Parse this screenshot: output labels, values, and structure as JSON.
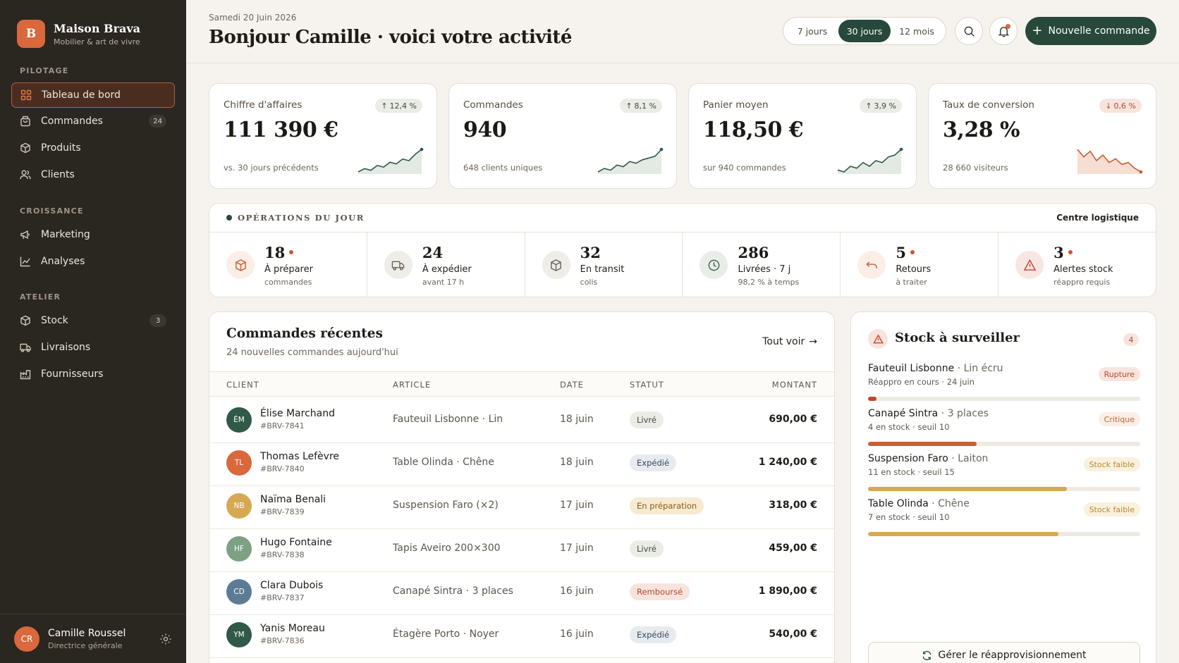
{
  "brand": {
    "initial": "B",
    "name": "Maison Brava",
    "tagline": "Mobilier & art de vivre"
  },
  "sidebar": {
    "sections": [
      {
        "label": "PILOTAGE"
      },
      {
        "label": "CROISSANCE"
      },
      {
        "label": "ATELIER"
      }
    ],
    "items": [
      {
        "label": "Tableau de bord",
        "icon": "grid-icon"
      },
      {
        "label": "Commandes",
        "badge": "24",
        "icon": "bag-icon"
      },
      {
        "label": "Produits",
        "icon": "box-icon"
      },
      {
        "label": "Clients",
        "icon": "users-icon"
      },
      {
        "label": "Marketing",
        "icon": "megaphone-icon"
      },
      {
        "label": "Analyses",
        "icon": "chart-icon"
      },
      {
        "label": "Stock",
        "badge": "3",
        "icon": "box-icon"
      },
      {
        "label": "Livraisons",
        "icon": "truck-icon"
      },
      {
        "label": "Fournisseurs",
        "icon": "factory-icon"
      }
    ]
  },
  "user": {
    "initials": "CR",
    "name": "Camille Roussel",
    "role": "Directrice générale"
  },
  "header": {
    "date": "Samedi 20 Juin 2026",
    "greeting": "Bonjour Camille · voici votre activité",
    "ranges": [
      "7 jours",
      "30 jours",
      "12 mois"
    ],
    "active_range": "30 jours",
    "new_order": "Nouvelle commande"
  },
  "kpis": [
    {
      "label": "Chiffre d'affaires",
      "delta": "12,4 %",
      "direction": "up",
      "value": "111 390 €",
      "sub": "vs. 30 jours précédents",
      "trend": [
        3,
        5,
        4,
        7,
        6,
        9,
        8,
        11,
        10,
        14,
        17
      ]
    },
    {
      "label": "Commandes",
      "delta": "8,1 %",
      "direction": "up",
      "value": "940",
      "sub": "648 clients uniques",
      "trend": [
        2,
        4,
        3,
        6,
        5,
        8,
        7,
        9,
        10,
        11,
        15
      ]
    },
    {
      "label": "Panier moyen",
      "delta": "3,9 %",
      "direction": "up",
      "value": "118,50 €",
      "sub": "sur 940 commandes",
      "trend": [
        3,
        2,
        5,
        4,
        7,
        5,
        8,
        7,
        10,
        11,
        14
      ]
    },
    {
      "label": "Taux de conversion",
      "delta": "0,6 %",
      "direction": "down",
      "value": "3,28 %",
      "sub": "28 660 visiteurs",
      "trend": [
        15,
        11,
        14,
        9,
        12,
        8,
        10,
        7,
        8,
        5,
        3
      ]
    }
  ],
  "operations": {
    "title": "OPÉRATIONS DU JOUR",
    "link": "Centre logistique",
    "items": [
      {
        "value": "18",
        "alert": true,
        "label": "À préparer",
        "sub": "commandes",
        "icon": "package-icon",
        "tone": "orange"
      },
      {
        "value": "24",
        "alert": false,
        "label": "À expédier",
        "sub": "avant 17 h",
        "icon": "truck-icon",
        "tone": "grey"
      },
      {
        "value": "32",
        "alert": false,
        "label": "En transit",
        "sub": "colis",
        "icon": "box-icon",
        "tone": "grey"
      },
      {
        "value": "286",
        "alert": false,
        "label": "Livrées · 7 j",
        "sub": "98,2 % à temps",
        "icon": "clock-icon",
        "tone": "green"
      },
      {
        "value": "5",
        "alert": true,
        "label": "Retours",
        "sub": "à traiter",
        "icon": "return-icon",
        "tone": "orange"
      },
      {
        "value": "3",
        "alert": true,
        "label": "Alertes stock",
        "sub": "réappro requis",
        "icon": "warning-icon",
        "tone": "red"
      }
    ]
  },
  "orders": {
    "title": "Commandes récentes",
    "subtitle": "24 nouvelles commandes aujourd'hui",
    "see_all": "Tout voir",
    "columns": [
      "CLIENT",
      "ARTICLE",
      "DATE",
      "STATUT",
      "MONTANT"
    ],
    "rows": [
      {
        "initials": "ÉM",
        "color": "#2f5a47",
        "client": "Élise Marchand",
        "id": "#BRV-7841",
        "article": "Fauteuil Lisbonne · Lin",
        "date": "18 juin",
        "status": "Livré",
        "status_type": "livre",
        "amount": "690,00 €"
      },
      {
        "initials": "TL",
        "color": "#d9683c",
        "client": "Thomas Lefèvre",
        "id": "#BRV-7840",
        "article": "Table Olinda · Chêne",
        "date": "18 juin",
        "status": "Expédié",
        "status_type": "expedie",
        "amount": "1 240,00 €"
      },
      {
        "initials": "NB",
        "color": "#d6a852",
        "client": "Naïma Benali",
        "id": "#BRV-7839",
        "article": "Suspension Faro (×2)",
        "date": "17 juin",
        "status": "En préparation",
        "status_type": "prep",
        "amount": "318,00 €"
      },
      {
        "initials": "HF",
        "color": "#7da283",
        "client": "Hugo Fontaine",
        "id": "#BRV-7838",
        "article": "Tapis Aveiro 200×300",
        "date": "17 juin",
        "status": "Livré",
        "status_type": "livre",
        "amount": "459,00 €"
      },
      {
        "initials": "CD",
        "color": "#5c7b94",
        "client": "Clara Dubois",
        "id": "#BRV-7837",
        "article": "Canapé Sintra · 3 places",
        "date": "16 juin",
        "status": "Remboursé",
        "status_type": "rembourse",
        "amount": "1 890,00 €"
      },
      {
        "initials": "YM",
        "color": "#2f5a47",
        "client": "Yanis Moreau",
        "id": "#BRV-7836",
        "article": "Étagère Porto · Noyer",
        "date": "16 juin",
        "status": "Expédié",
        "status_type": "expedie",
        "amount": "540,00 €"
      }
    ]
  },
  "stock": {
    "title": "Stock à surveiller",
    "count": "4",
    "items": [
      {
        "name": "Fauteuil Lisbonne",
        "variant": "· Lin écru",
        "sub": "Réappro en cours · 24 juin",
        "tag": "Rupture",
        "tag_type": "rupture",
        "level": 0.03,
        "color": "#c4452a"
      },
      {
        "name": "Canapé Sintra",
        "variant": "· 3 places",
        "sub": "4 en stock · seuil 10",
        "tag": "Critique",
        "tag_type": "critique",
        "level": 0.4,
        "color": "#c65f34"
      },
      {
        "name": "Suspension Faro",
        "variant": "· Laiton",
        "sub": "11 en stock · seuil 15",
        "tag": "Stock faible",
        "tag_type": "faible",
        "level": 0.73,
        "color": "#d6a852"
      },
      {
        "name": "Table Olinda",
        "variant": "· Chêne",
        "sub": "7 en stock · seuil 10",
        "tag": "Stock faible",
        "tag_type": "faible",
        "level": 0.7,
        "color": "#d6a852"
      }
    ],
    "button": "Gérer le réapprovisionnement"
  },
  "colors": {
    "accent": "#d9683c",
    "primary": "#27483a",
    "sidebar": "#2a2620"
  }
}
